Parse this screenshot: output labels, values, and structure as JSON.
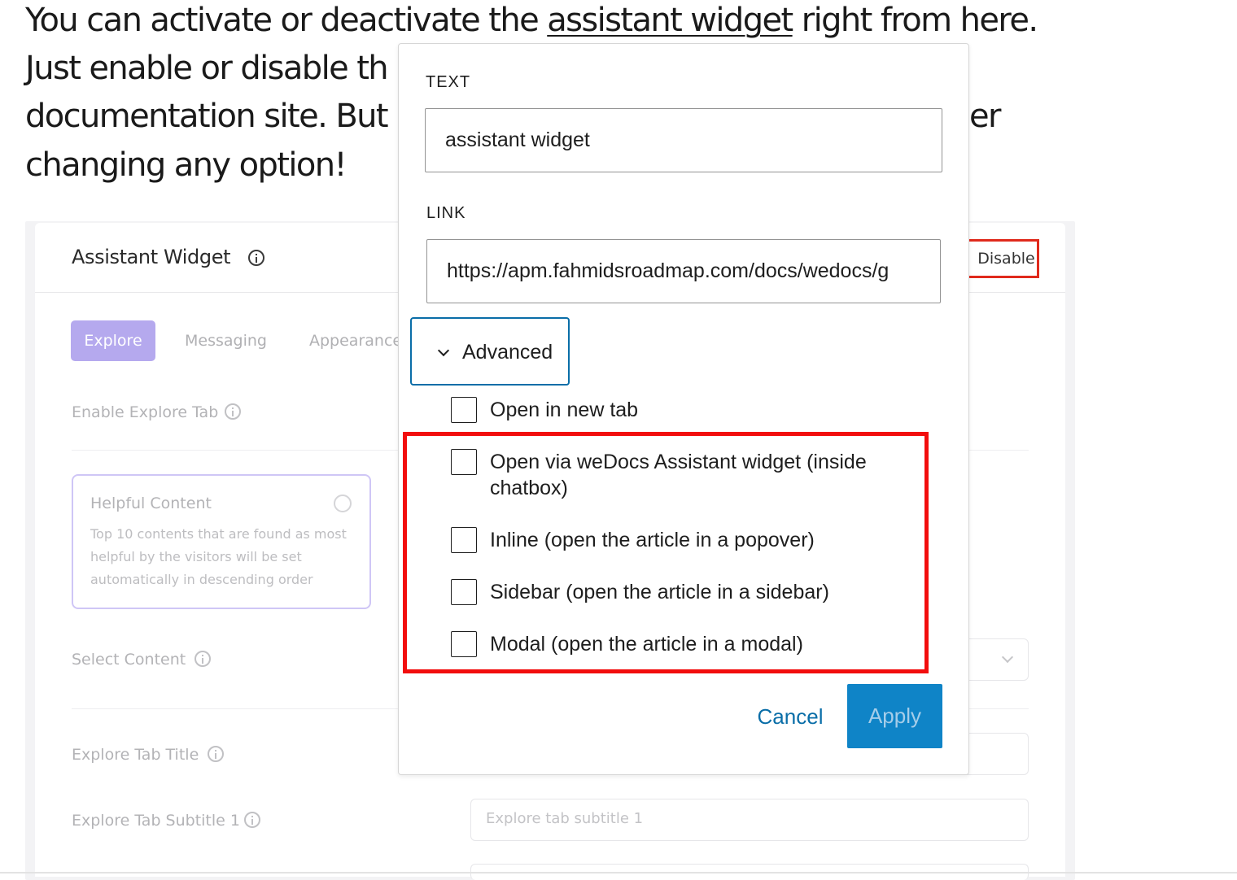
{
  "article": {
    "line1_before": "You can activate or deactivate the ",
    "line1_link": "assistant widget",
    "line1_after": " right from here.",
    "line2": "Just enable or disable th",
    "line3": "documentation site. But",
    "line3_tail": "er",
    "line4": "changing any option!"
  },
  "settings_panel": {
    "title": "Assistant Widget",
    "disable_button": "Disable",
    "tabs": [
      "Explore",
      "Messaging",
      "Appearance"
    ],
    "enable_explore_label": "Enable Explore Tab",
    "card": {
      "title": "Helpful Content",
      "description": "Top 10 contents that are found as most helpful by the visitors will be set automatically in descending order"
    },
    "select_content_label": "Select Content",
    "explore_tab_title_label": "Explore Tab Title",
    "explore_tab_subtitle_label": "Explore Tab Subtitle 1",
    "explore_tab_subtitle_placeholder": "Explore tab subtitle 1"
  },
  "popover": {
    "text_label": "TEXT",
    "text_value": "assistant widget",
    "link_label": "LINK",
    "link_value": "https://apm.fahmidsroadmap.com/docs/wedocs/g",
    "advanced_label": "Advanced",
    "options": [
      {
        "label": "Open in new tab",
        "checked": false
      },
      {
        "label": "Open via weDocs Assistant widget (inside chatbox)",
        "checked": false
      },
      {
        "label": "Inline (open the article in a popover)",
        "checked": false
      },
      {
        "label": "Sidebar (open the article in a sidebar)",
        "checked": false
      },
      {
        "label": "Modal (open the article in a modal)",
        "checked": false
      }
    ],
    "cancel_label": "Cancel",
    "apply_label": "Apply"
  },
  "colors": {
    "accent_blue": "#0f84c7",
    "link_blue": "#0a6ea8",
    "highlight_red": "#f20d0d",
    "explore_tab_purple": "#b5a9ee"
  },
  "icons": [
    "info-icon",
    "chevron-down-icon",
    "checkbox-icon",
    "radio-icon"
  ]
}
